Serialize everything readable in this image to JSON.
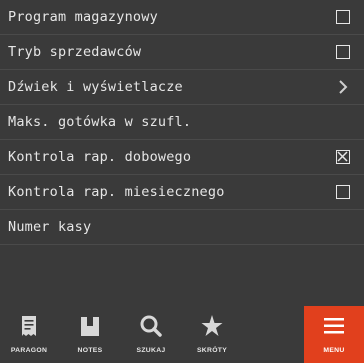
{
  "settings": [
    {
      "label": "Program magazynowy",
      "control": "checkbox",
      "checked": false
    },
    {
      "label": "Tryb sprzedawców",
      "control": "checkbox",
      "checked": false
    },
    {
      "label": "Dźwiek i wyświetlacze",
      "control": "chevron"
    },
    {
      "label": "Maks. gotówka w szufl.",
      "control": "none"
    },
    {
      "label": "Kontrola rap. dobowego",
      "control": "checkbox",
      "checked": true
    },
    {
      "label": "Kontrola rap. miesiecznego",
      "control": "checkbox",
      "checked": false
    },
    {
      "label": "Numer kasy",
      "control": "none"
    }
  ],
  "tabs": [
    {
      "label": "PARAGON",
      "icon": "receipt-icon"
    },
    {
      "label": "NOTES",
      "icon": "notebook-icon"
    },
    {
      "label": "SZUKAJ",
      "icon": "search-icon"
    },
    {
      "label": "SKRÓTY",
      "icon": "star-icon"
    },
    {
      "label": "MENU",
      "icon": "hamburger-menu-icon"
    }
  ],
  "colors": {
    "background": "#3a3a3a",
    "accent": "#e1401d",
    "text": "#e6e6e6"
  }
}
